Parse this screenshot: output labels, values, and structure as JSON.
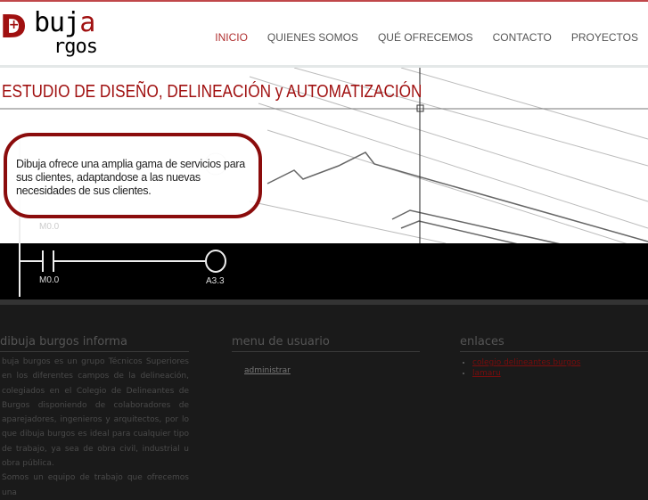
{
  "logo": {
    "text": "Dibuja Burgos"
  },
  "nav": [
    {
      "label": "INICIO",
      "active": true
    },
    {
      "label": "QUIENES SOMOS"
    },
    {
      "label": "QUÉ OFRECEMOS"
    },
    {
      "label": "CONTACTO"
    },
    {
      "label": "PROYECTOS"
    }
  ],
  "banner": {
    "title": "ESTUDIO DE DISEÑO, DELINEACIÓN y AUTOMATIZACIÓN",
    "bubble": "Dibuja ofrece una amplia gama de servicios para sus clientes, adaptandose a las nuevas necesidades de sus clientes.",
    "contact_label": "M0.0",
    "coil_label": "A3.3",
    "faded_label": "M0.0"
  },
  "footer": {
    "informa": {
      "title": "dibuja burgos informa",
      "paragraphs": [
        "buja burgos es un grupo Técnicos Superiores en los diferentes campos de la delineación, colegiados en el Colegio de Delineantes de Burgos disponiendo de colaboradores de aparejadores, ingenieros y arquitectos, por lo que dibuja burgos es ideal para cualquier tipo de trabajo, ya sea de obra civil, industrial u obra pública.",
        "Somos un equipo de trabajo que ofrecemos una"
      ]
    },
    "menu": {
      "title": "menu de usuario",
      "link": "administrar"
    },
    "enlaces": {
      "title": "enlaces",
      "links": [
        "colegio delineantes burgos",
        "lamaru"
      ]
    }
  }
}
